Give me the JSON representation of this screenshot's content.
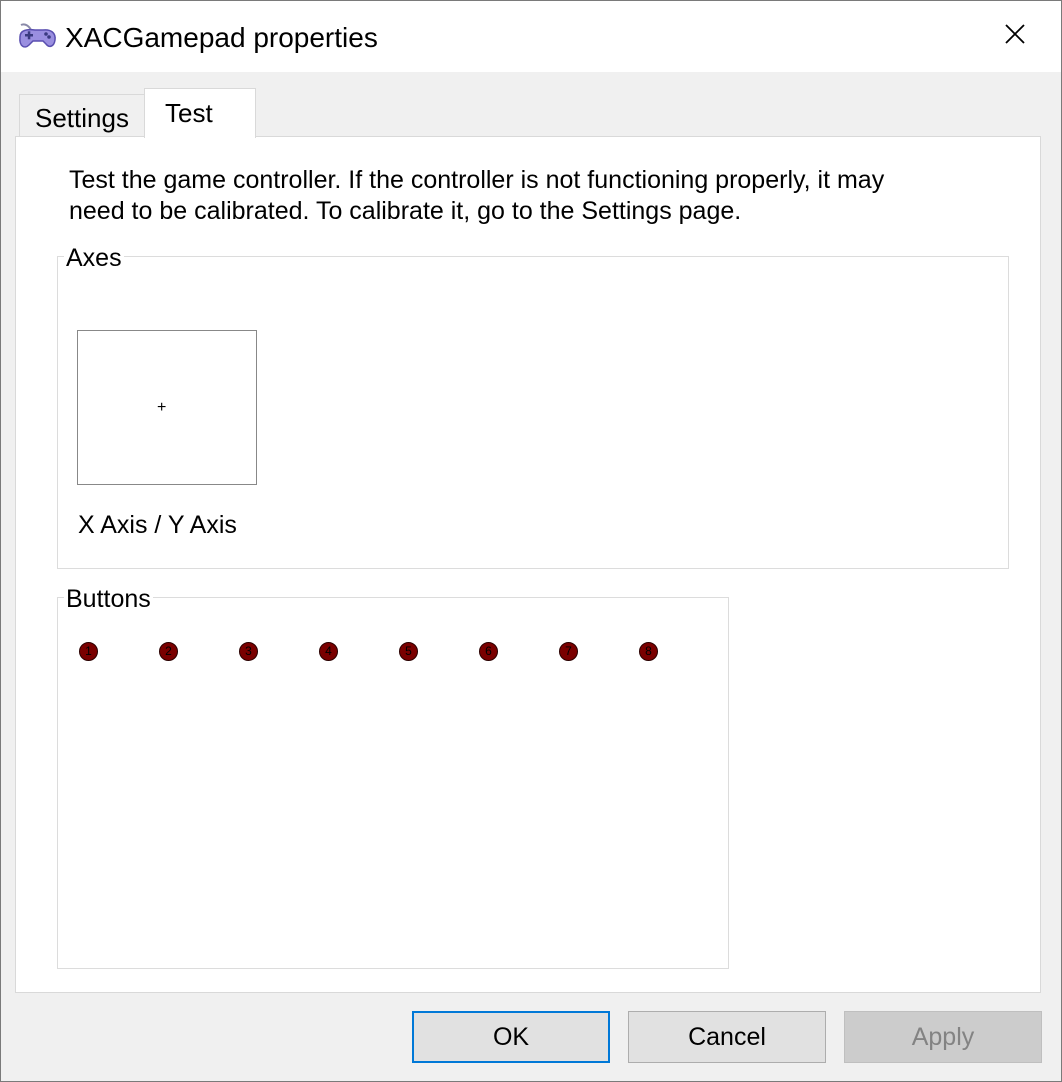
{
  "window": {
    "title": "XACGamepad properties",
    "app_icon": "gamepad-icon",
    "close_icon": "close-icon"
  },
  "tabs": [
    {
      "label": "Settings",
      "active": false
    },
    {
      "label": "Test",
      "active": true
    }
  ],
  "test_page": {
    "intro_text": "Test the game controller.  If the controller is not functioning properly, it may\nneed to be calibrated.  To calibrate it, go to the Settings page.",
    "axes": {
      "group_label": "Axes",
      "axis_caption": "X Axis / Y Axis",
      "crosshair": "+"
    },
    "buttons": {
      "group_label": "Buttons",
      "indicators": [
        "1",
        "2",
        "3",
        "4",
        "5",
        "6",
        "7",
        "8"
      ],
      "indicator_color": "#7a0000"
    }
  },
  "footer": {
    "ok_label": "OK",
    "cancel_label": "Cancel",
    "apply_label": "Apply"
  },
  "colors": {
    "focus_border": "#0078d7",
    "disabled_text": "#838383"
  }
}
